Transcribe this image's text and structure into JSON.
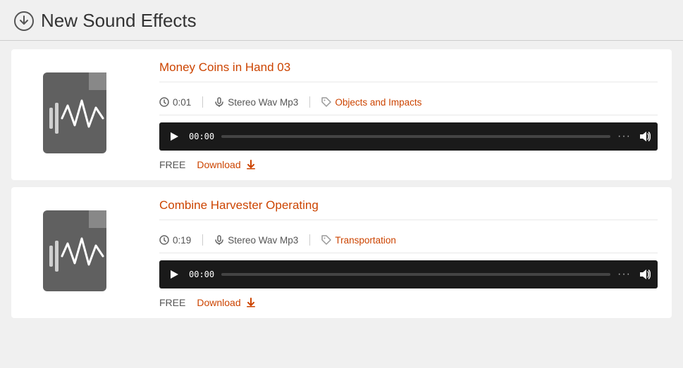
{
  "header": {
    "title": "New Sound Effects",
    "icon": "download-circle-icon"
  },
  "sounds": [
    {
      "id": "sound-1",
      "title": "Money Coins in Hand 03",
      "duration": "0:01",
      "format": "Stereo Wav Mp3",
      "category": "Objects and Impacts",
      "player_time": "00:00",
      "price": "FREE",
      "download_label": "Download"
    },
    {
      "id": "sound-2",
      "title": "Combine Harvester Operating",
      "duration": "0:19",
      "format": "Stereo Wav Mp3",
      "category": "Transportation",
      "player_time": "00:00",
      "price": "FREE",
      "download_label": "Download"
    }
  ],
  "icons": {
    "play": "▶",
    "dots": "...",
    "volume": "🔊",
    "download_arrow": "⬇",
    "clock": "⏱",
    "mic": "🎤",
    "tag": "🏷"
  }
}
